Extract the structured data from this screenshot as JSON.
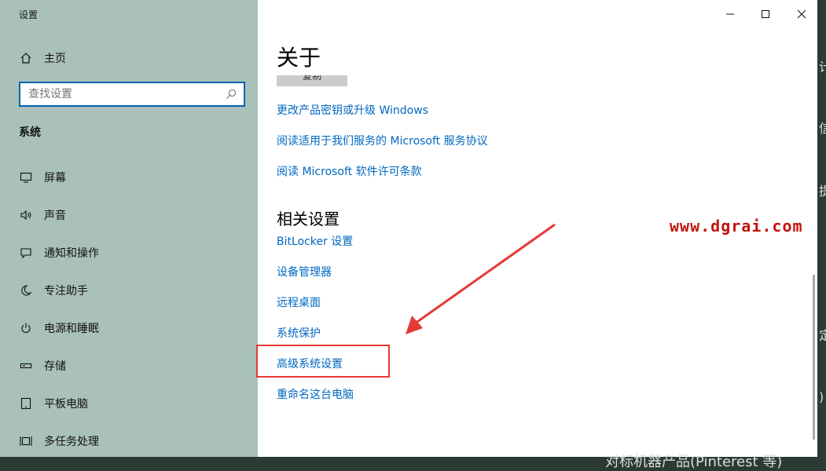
{
  "window": {
    "title": "设置",
    "controls": {
      "minimize": "—",
      "maximize": "☐",
      "close": "✕"
    }
  },
  "sidebar": {
    "home_label": "主页",
    "search_placeholder": "查找设置",
    "section_label": "系统",
    "items": [
      {
        "label": "屏幕",
        "icon": "display-icon"
      },
      {
        "label": "声音",
        "icon": "speaker-icon"
      },
      {
        "label": "通知和操作",
        "icon": "notification-icon"
      },
      {
        "label": "专注助手",
        "icon": "moon-icon"
      },
      {
        "label": "电源和睡眠",
        "icon": "power-icon"
      },
      {
        "label": "存储",
        "icon": "storage-icon"
      },
      {
        "label": "平板电脑",
        "icon": "tablet-icon"
      },
      {
        "label": "多任务处理",
        "icon": "multitask-icon"
      }
    ]
  },
  "main": {
    "title": "关于",
    "refresh_label": "复制",
    "links": [
      "更改产品密钥或升级 Windows",
      "阅读适用于我们服务的 Microsoft 服务协议",
      "阅读 Microsoft 软件许可条款"
    ],
    "related_heading": "相关设置",
    "related_links": [
      "BitLocker 设置",
      "设备管理器",
      "远程桌面",
      "系统保护",
      "高级系统设置",
      "重命名这台电脑"
    ]
  },
  "annotation": {
    "watermark": "www.dgrai.com",
    "highlight_color": "#e53935",
    "arrow_color": "#e53935"
  },
  "background": {
    "bottom_text": "对标机器产品(Pinterest 等)",
    "right_fragments": [
      "计",
      "信",
      "提",
      "定",
      ")"
    ]
  },
  "colors": {
    "sidebar_bg": "#a9c1b9",
    "link": "#0067c0",
    "accent": "#0063b1"
  }
}
